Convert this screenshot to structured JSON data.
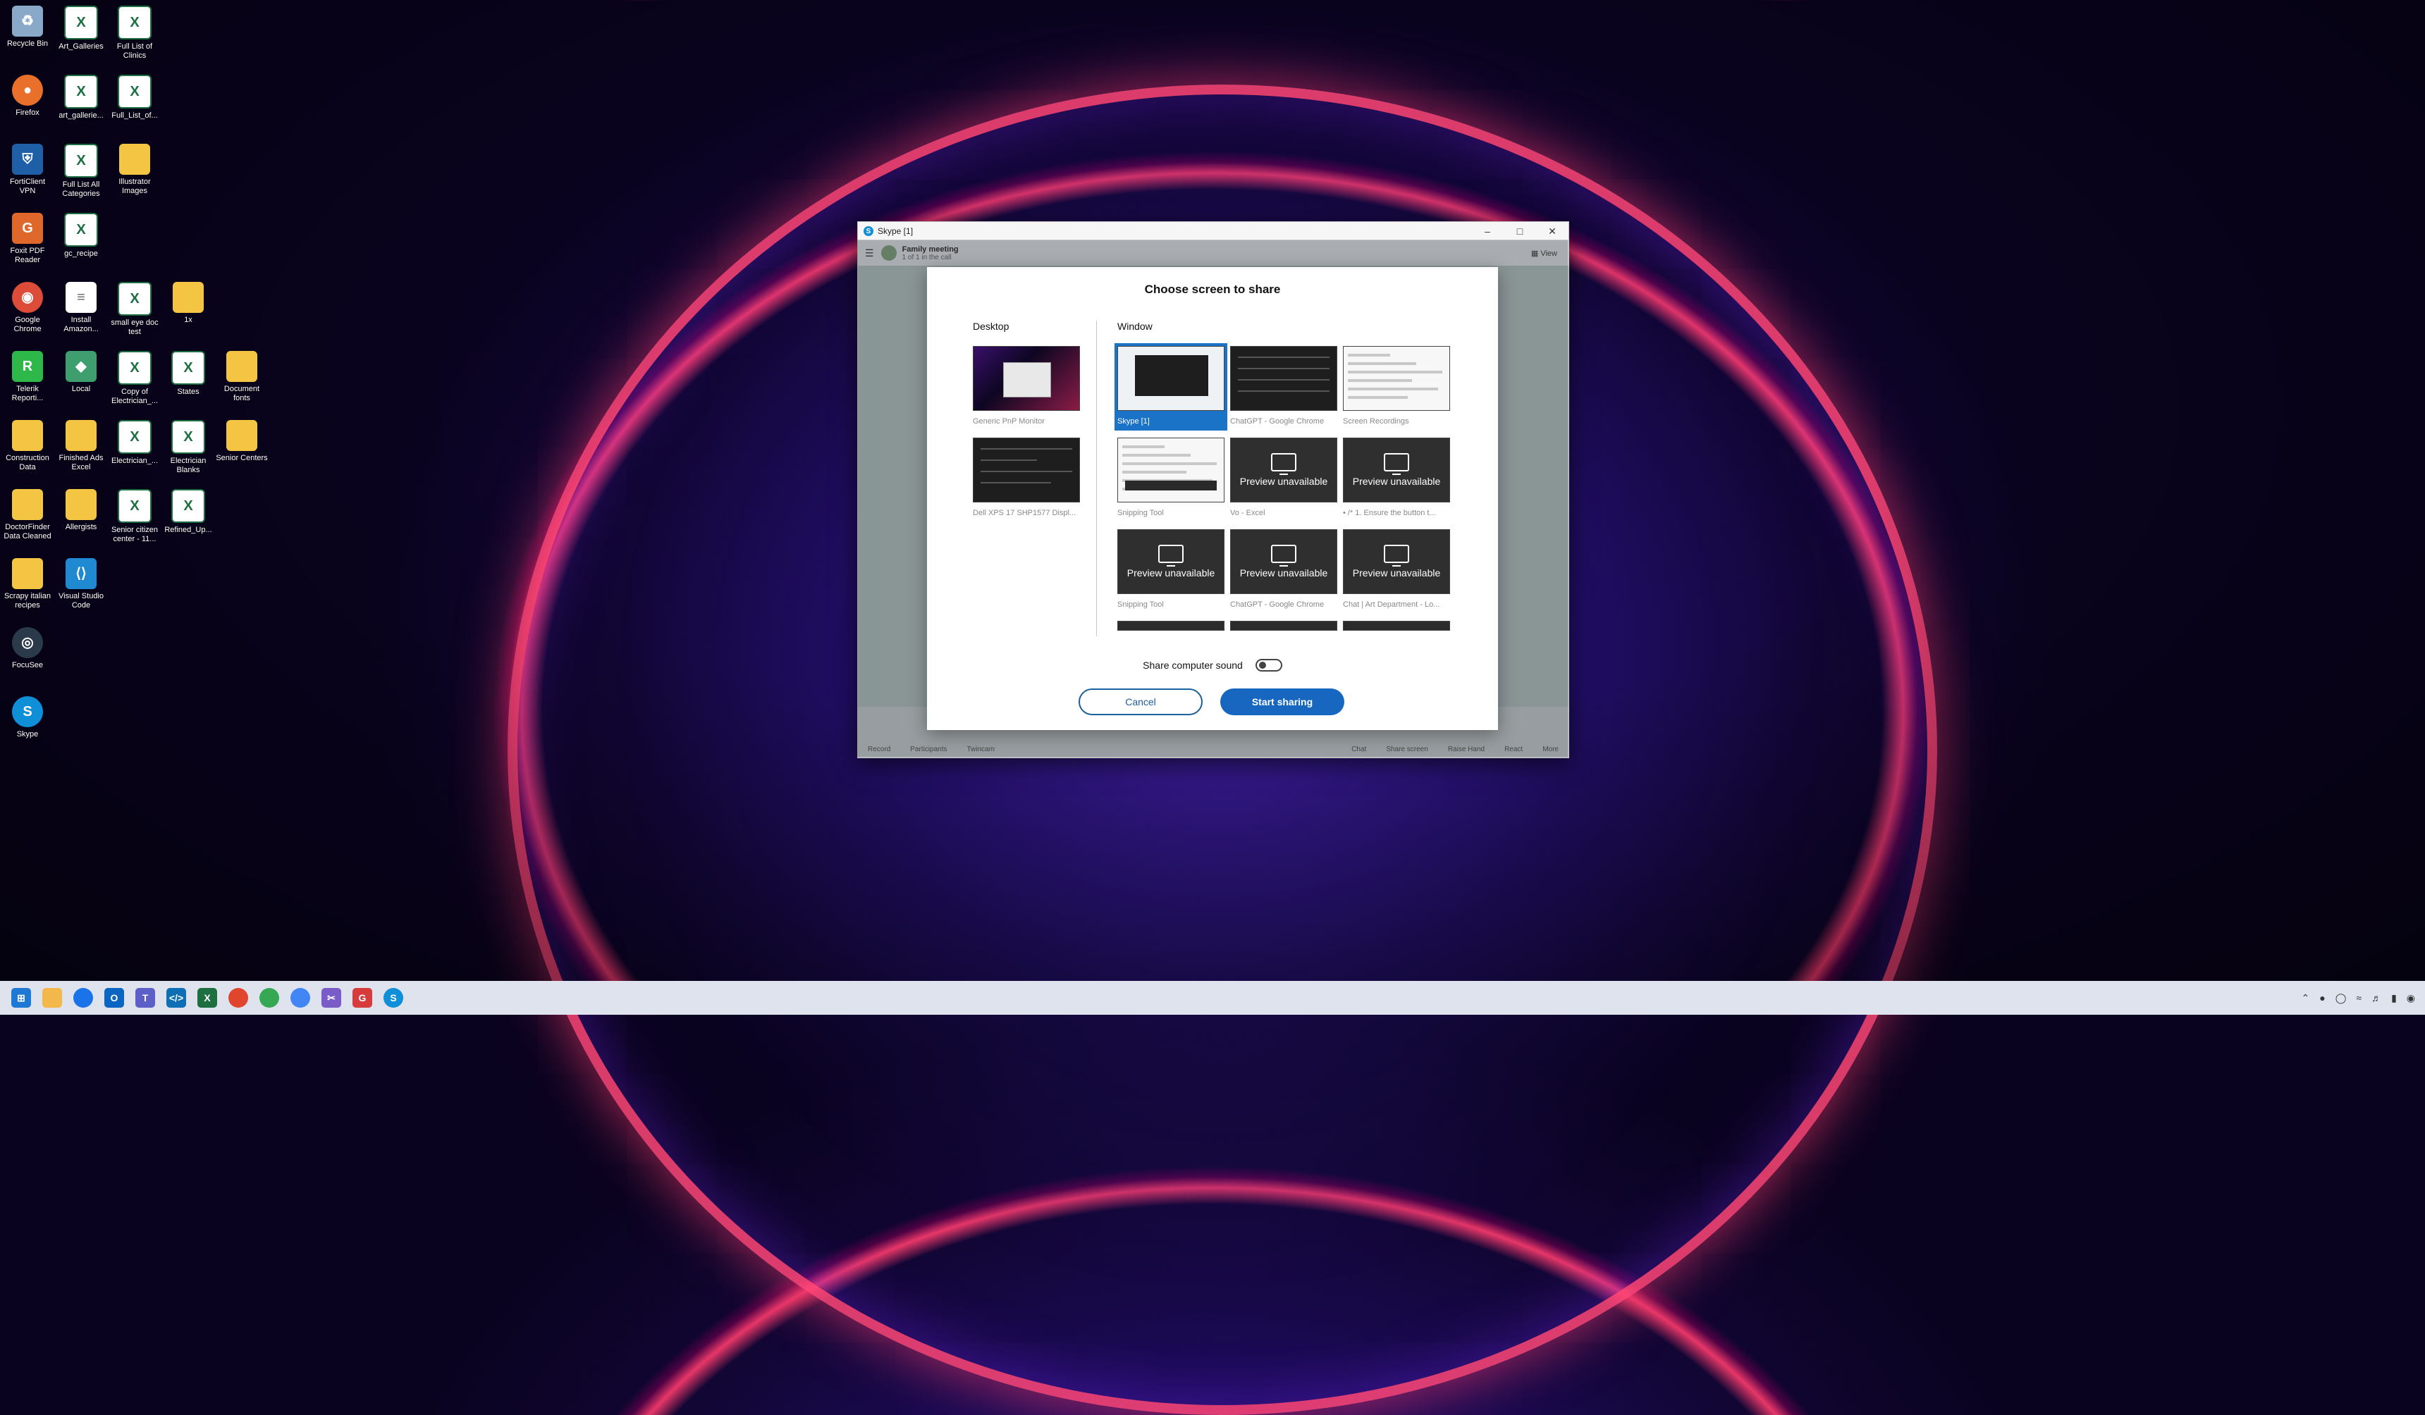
{
  "desktop_icons": [
    {
      "label": "Recycle Bin",
      "icon": "recycle-bin-icon",
      "col": 0,
      "row": 0
    },
    {
      "label": "Art_Galleries",
      "icon": "excel-icon",
      "col": 1,
      "row": 0
    },
    {
      "label": "Full List of Clinics",
      "icon": "excel-icon",
      "col": 2,
      "row": 0
    },
    {
      "label": "Firefox",
      "icon": "firefox-icon",
      "col": 0,
      "row": 1
    },
    {
      "label": "art_gallerie...",
      "icon": "excel-icon",
      "col": 1,
      "row": 1
    },
    {
      "label": "Full_List_of...",
      "icon": "excel-icon",
      "col": 2,
      "row": 1
    },
    {
      "label": "FortiClient VPN",
      "icon": "forticlient-icon",
      "col": 0,
      "row": 2
    },
    {
      "label": "Full List All Categories",
      "icon": "excel-icon",
      "col": 1,
      "row": 2
    },
    {
      "label": "Illustrator Images",
      "icon": "folder-icon",
      "col": 2,
      "row": 2
    },
    {
      "label": "Foxit PDF Reader",
      "icon": "foxit-icon",
      "col": 0,
      "row": 3
    },
    {
      "label": "gc_recipe",
      "icon": "excel-icon",
      "col": 1,
      "row": 3
    },
    {
      "label": "Google Chrome",
      "icon": "chrome-icon",
      "col": 0,
      "row": 4
    },
    {
      "label": "Install Amazon...",
      "icon": "document-icon",
      "col": 1,
      "row": 4
    },
    {
      "label": "small eye doc test",
      "icon": "excel-icon",
      "col": 2,
      "row": 4
    },
    {
      "label": "1x",
      "icon": "folder-icon",
      "col": 3,
      "row": 4
    },
    {
      "label": "Telerik Reporti...",
      "icon": "telerik-icon",
      "col": 0,
      "row": 5
    },
    {
      "label": "Local",
      "icon": "local-icon",
      "col": 1,
      "row": 5
    },
    {
      "label": "Copy of Electrician_...",
      "icon": "excel-icon",
      "col": 2,
      "row": 5
    },
    {
      "label": "States",
      "icon": "excel-icon",
      "col": 3,
      "row": 5
    },
    {
      "label": "Document fonts",
      "icon": "folder-icon",
      "col": 4,
      "row": 5
    },
    {
      "label": "Construction Data",
      "icon": "folder-icon",
      "col": 0,
      "row": 6
    },
    {
      "label": "Finished Ads Excel",
      "icon": "folder-icon",
      "col": 1,
      "row": 6
    },
    {
      "label": "Electrician_...",
      "icon": "excel-icon",
      "col": 2,
      "row": 6
    },
    {
      "label": "Electrician Blanks",
      "icon": "excel-icon",
      "col": 3,
      "row": 6
    },
    {
      "label": "Senior Centers",
      "icon": "folder-icon",
      "col": 4,
      "row": 6
    },
    {
      "label": "DoctorFinder Data Cleaned",
      "icon": "folder-icon",
      "col": 0,
      "row": 7
    },
    {
      "label": "Allergists",
      "icon": "folder-icon",
      "col": 1,
      "row": 7
    },
    {
      "label": "Senior citizen center - 11...",
      "icon": "excel-icon",
      "col": 2,
      "row": 7
    },
    {
      "label": "Refined_Up...",
      "icon": "excel-icon",
      "col": 3,
      "row": 7
    },
    {
      "label": "Scrapy italian recipes",
      "icon": "folder-icon",
      "col": 0,
      "row": 8
    },
    {
      "label": "Visual Studio Code",
      "icon": "vscode-icon",
      "col": 1,
      "row": 8
    },
    {
      "label": "FocuSee",
      "icon": "focusee-icon",
      "col": 0,
      "row": 9
    },
    {
      "label": "Skype",
      "icon": "skype-icon",
      "col": 0,
      "row": 10
    }
  ],
  "skype_window": {
    "title": "Skype [1]",
    "meeting_name": "Family meeting",
    "meeting_sub": "1 of 1 in the call",
    "view_label": "View",
    "toolbar": [
      "Record",
      "Participants",
      "Twincam",
      "Chat",
      "Share screen",
      "Raise Hand",
      "React",
      "More"
    ]
  },
  "dialog": {
    "title": "Choose screen to share",
    "desktop_heading": "Desktop",
    "window_heading": "Window",
    "desktop_items": [
      {
        "label": "Generic PnP Monitor"
      },
      {
        "label": "Dell XPS 17 SHP1577 Displ..."
      }
    ],
    "window_items": [
      {
        "label": "Skype [1]",
        "kind": "skype",
        "selected": true
      },
      {
        "label": "ChatGPT - Google Chrome",
        "kind": "dark"
      },
      {
        "label": "Screen Recordings",
        "kind": "light"
      },
      {
        "label": "Snipping Tool",
        "kind": "light2"
      },
      {
        "label": "Vo - Excel",
        "kind": "unavailable"
      },
      {
        "label": "• /* 1. Ensure the button t...",
        "kind": "unavailable"
      },
      {
        "label": "Snipping Tool",
        "kind": "unavailable"
      },
      {
        "label": "ChatGPT - Google Chrome",
        "kind": "unavailable"
      },
      {
        "label": "Chat | Art Department - Lo...",
        "kind": "unavailable"
      }
    ],
    "preview_unavailable": "Preview unavailable",
    "share_sound_label": "Share computer sound",
    "cancel_label": "Cancel",
    "start_label": "Start sharing"
  },
  "colors": {
    "accent": "#1767c1",
    "selected": "#1a73c7"
  }
}
